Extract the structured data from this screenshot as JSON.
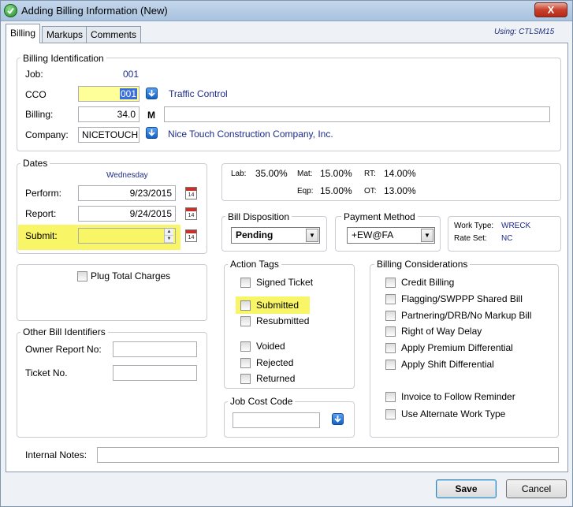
{
  "window": {
    "title": "Adding Billing Information  (New)",
    "close_label": "X"
  },
  "tabs": [
    "Billing",
    "Markups",
    "Comments"
  ],
  "using": "Using:  CTLSM15",
  "billing_identification": {
    "legend": "Billing Identification",
    "job_label": "Job:",
    "job_value": "001",
    "cco_label": "CCO",
    "cco_value": "001",
    "cco_desc": "Traffic Control",
    "billing_label": "Billing:",
    "billing_value": "34.0",
    "billing_suffix": "M",
    "billing_desc": "",
    "company_label": "Company:",
    "company_value": "NICETOUCH",
    "company_desc": "Nice Touch Construction Company, Inc."
  },
  "dates": {
    "legend": "Dates",
    "weekday": "Wednesday",
    "perform_label": "Perform:",
    "perform_value": "9/23/2015",
    "report_label": "Report:",
    "report_value": "9/24/2015",
    "submit_label": "Submit:",
    "submit_value": "",
    "cal_day": "14"
  },
  "rates": {
    "lab_label": "Lab:",
    "lab_value": "35.00%",
    "mat_label": "Mat:",
    "mat_value": "15.00%",
    "rt_label": "RT:",
    "rt_value": "14.00%",
    "eqp_label": "Eqp:",
    "eqp_value": "15.00%",
    "ot_label": "OT:",
    "ot_value": "13.00%"
  },
  "bill_disposition": {
    "legend": "Bill Disposition",
    "value": "Pending"
  },
  "payment_method": {
    "legend": "Payment Method",
    "value": "+EW@FA"
  },
  "work_info": {
    "work_type_label": "Work Type:",
    "work_type_value": "WRECK",
    "rate_set_label": "Rate Set:",
    "rate_set_value": "NC"
  },
  "plug_total_label": "Plug Total Charges",
  "other_identifiers": {
    "legend": "Other Bill Identifiers",
    "owner_report_label": "Owner Report No:",
    "owner_report_value": "",
    "ticket_label": "Ticket No.",
    "ticket_value": ""
  },
  "action_tags": {
    "legend": "Action Tags",
    "items": [
      "Signed Ticket",
      "Submitted",
      "Resubmitted",
      "Voided",
      "Rejected",
      "Returned"
    ]
  },
  "job_cost_code": {
    "legend": "Job Cost Code",
    "value": ""
  },
  "billing_considerations": {
    "legend": "Billing Considerations",
    "items": [
      "Credit Billing",
      "Flagging/SWPPP Shared Bill",
      "Partnering/DRB/No Markup Bill",
      "Right of Way Delay",
      "Apply Premium Differential",
      "Apply Shift Differential",
      "Invoice to Follow Reminder",
      "Use Alternate Work Type"
    ]
  },
  "internal_notes": {
    "label": "Internal Notes:",
    "value": ""
  },
  "buttons": {
    "save": "Save",
    "cancel": "Cancel"
  },
  "colors": {
    "highlight": "#f8f566",
    "value_text": "#1c2a8a"
  }
}
